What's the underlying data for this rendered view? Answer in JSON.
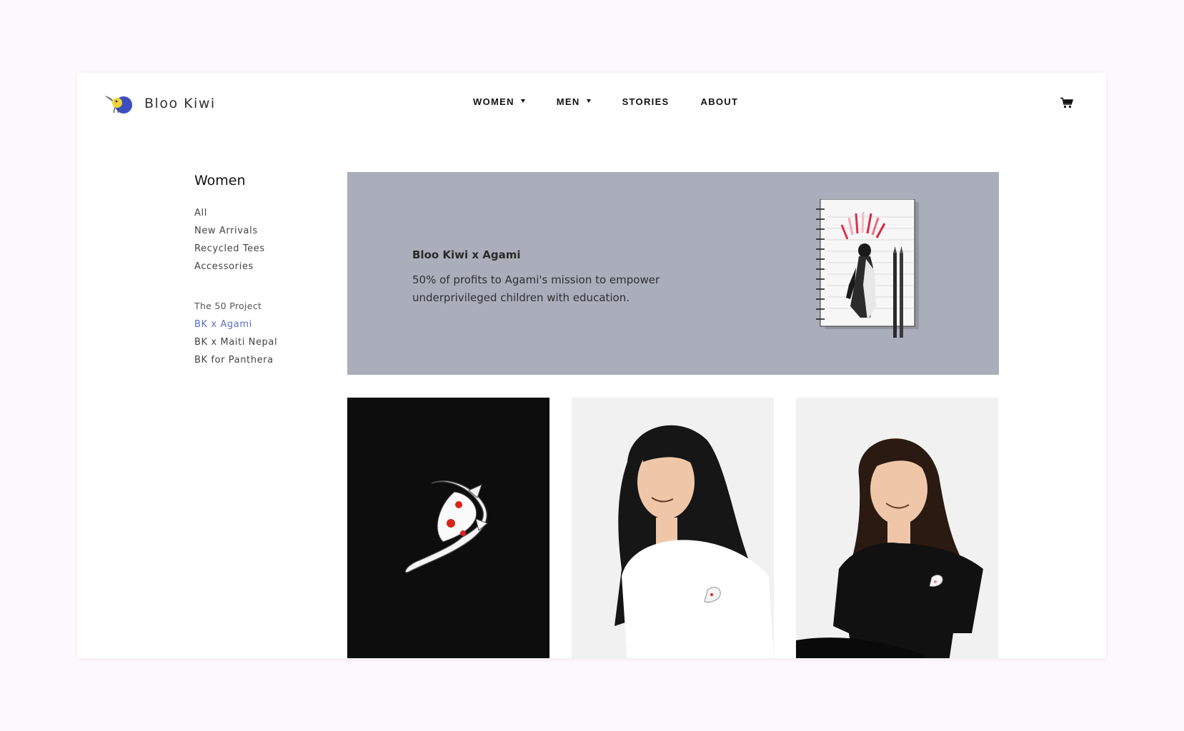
{
  "brand": {
    "name": "Bloo Kiwi",
    "logo_icon": "kiwi-bird-icon"
  },
  "nav": {
    "items": [
      {
        "label": "WOMEN",
        "has_dropdown": true
      },
      {
        "label": "MEN",
        "has_dropdown": true
      },
      {
        "label": "STORIES",
        "has_dropdown": false
      },
      {
        "label": "ABOUT",
        "has_dropdown": false
      }
    ],
    "cart_icon": "cart-icon"
  },
  "sidebar": {
    "title": "Women",
    "categories": [
      "All",
      "New Arrivals",
      "Recycled Tees",
      "Accessories"
    ],
    "project_heading": "The 50 Project",
    "projects": [
      {
        "label": "BK x Agami",
        "active": true
      },
      {
        "label": "BK x Maiti Nepal",
        "active": false
      },
      {
        "label": "BK for Panthera",
        "active": false
      }
    ]
  },
  "banner": {
    "title": "Bloo Kiwi x Agami",
    "description": "50% of profits to Agami's mission to empower underprivileged children with education.",
    "background": "#a9aeba",
    "illustration": "notebook-illustration"
  },
  "products": [
    {
      "image": "koi-patch-on-black-fabric"
    },
    {
      "image": "woman-in-white-koi-tee"
    },
    {
      "image": "woman-in-black-koi-tee"
    }
  ],
  "colors": {
    "accent_link": "#5a6ec9",
    "page_bg": "#fdf8fd",
    "logo_blue": "#3d4fc0",
    "logo_yellow": "#f0d43a"
  }
}
